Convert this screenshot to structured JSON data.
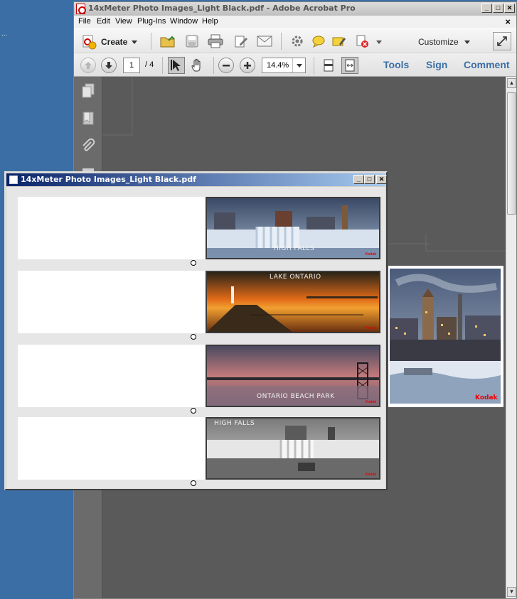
{
  "desktop": {
    "ellipsis": "..."
  },
  "main_window": {
    "title": "14xMeter Photo Images_Light Black.pdf - Adobe Acrobat Pro",
    "controls": {
      "minimize": "_",
      "maximize": "□",
      "close": "✕"
    }
  },
  "menu": {
    "items": [
      "File",
      "Edit",
      "View",
      "Plug-Ins",
      "Window",
      "Help"
    ],
    "close": "×"
  },
  "toolbar": {
    "create_label": "Create",
    "customize_label": "Customize"
  },
  "nav": {
    "current_page": "1",
    "total_pages": "/ 4",
    "zoom": "14.4%",
    "tools_label": "Tools",
    "sign_label": "Sign",
    "comment_label": "Comment"
  },
  "preview": {
    "kodak": "Kodak"
  },
  "float_window": {
    "title": "14xMeter Photo Images_Light Black.pdf",
    "controls": {
      "minimize": "_",
      "maximize": "□",
      "close": "✕"
    },
    "strips": [
      {
        "caption": "HIGH FALLS",
        "theme": "blue-winter"
      },
      {
        "caption": "LAKE ONTARIO",
        "theme": "orange-sunset"
      },
      {
        "caption": "ONTARIO BEACH PARK",
        "theme": "pink-dusk"
      },
      {
        "caption": "HIGH FALLS",
        "theme": "bw-winter"
      }
    ]
  }
}
